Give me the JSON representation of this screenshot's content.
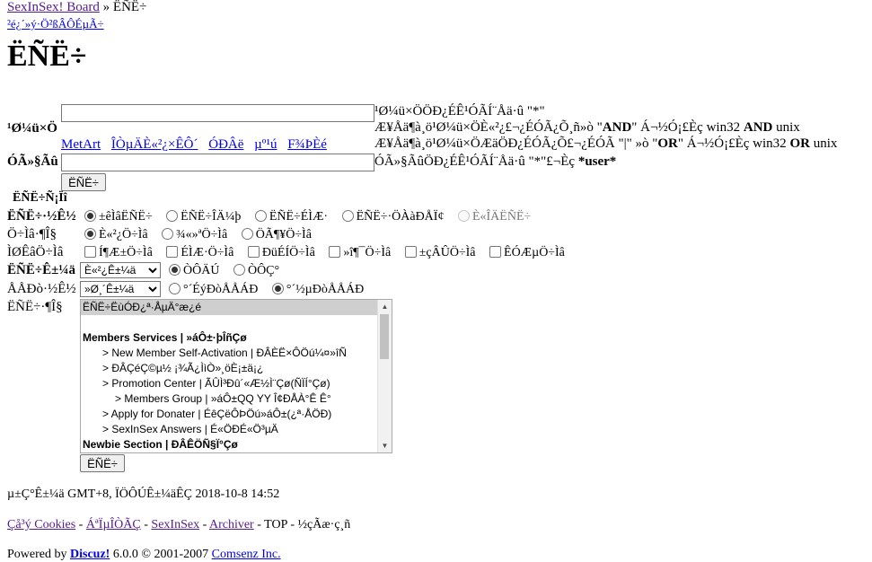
{
  "breadcrumb": {
    "board_link": "SexInSex! Board",
    "sep": "»",
    "current": "ËÑË÷",
    "sub_link": "²é¿´»ý·Ö²ßÂÔÉµÃ÷"
  },
  "page_title": "ËÑË÷",
  "form": {
    "keyword_label": "¹Ø¼ü×Ö",
    "keyword_hint": "¹Ø¼ü×ÖÖÐ¿ÉÊ¹ÓÃÍ¨Åä·û \"*\"",
    "keyword_hint2_a": "Æ¥Åä¶à¸ö¹Ø¼ü×ÖÈ«²¿£¬¿ÉÓÃ¿Õ¸ñ»ò \"",
    "keyword_hint2_b": "AND",
    "keyword_hint2_c": "\" Á¬½Ó¡£Èç win32 ",
    "keyword_hint2_d": "AND",
    "keyword_hint2_e": " unix",
    "keyword_hint3_a": "Æ¥Åä¶à¸ö¹Ø¼ü×ÖÆäÖÐ¿ÉÓÃ¿Õ£¬¿ÉÓÃ \"|\" »ò \"",
    "keyword_hint3_b": "OR",
    "keyword_hint3_c": "\" Á¬½Ó¡£Èç win32 ",
    "keyword_hint3_d": "OR",
    "keyword_hint3_e": " unix",
    "quick_links": [
      "MetArt",
      "ÎÒµÄÈ«²¿×ÊÔ´",
      "ÓÐÂë",
      "µº¹ú",
      "F¾ÞÈé"
    ],
    "author_label": "ÓÃ»§Ãû",
    "author_hint_a": "ÓÃ»§ÃûÖÐ¿ÉÊ¹ÓÃÍ¨Åä·û \"*\"£¬Èç ",
    "author_hint_b": "*user*",
    "search_button": "ËÑË÷",
    "options_title": "ËÑË÷Ñ¡Ïî",
    "mode_label": "ËÑË÷·½Ê½",
    "mode_options": [
      {
        "label": "±êÌâËÑË÷",
        "checked": true,
        "disabled": false
      },
      {
        "label": "ËÑË÷ÎÄ¼þ",
        "checked": false,
        "disabled": false
      },
      {
        "label": "ËÑË÷ÉÌÆ·",
        "checked": false,
        "disabled": false
      },
      {
        "label": "ËÑË÷·ÖÀàÐÅÏ¢",
        "checked": false,
        "disabled": false
      },
      {
        "label": "È«ÎÄËÑË÷",
        "checked": false,
        "disabled": true
      }
    ],
    "scope_label": "Ö÷Ìâ·¶Î§",
    "scope_options": [
      {
        "label": "È«²¿Ö÷Ìâ",
        "checked": true
      },
      {
        "label": "¾«»ªÖ÷Ìâ",
        "checked": false
      },
      {
        "label": "ÖÃ¶¥Ö÷Ìâ",
        "checked": false
      }
    ],
    "special_label": "ÌØÊâÖ÷Ìâ",
    "special_options": [
      "Í¶Æ±Ö÷Ìâ",
      "ÉÌÆ·Ö÷Ìâ",
      "ÐüÉÍÖ÷Ìâ",
      "»î¶¯Ö÷Ìâ",
      "±çÂÛÖ÷Ìâ",
      "ÊÓÆµÖ÷Ìâ"
    ],
    "time_label": "ËÑË÷Ê±¼ä",
    "time_select": "È«²¿Ê±¼ä",
    "time_radio": [
      {
        "label": "ÒÔÄÚ",
        "checked": true
      },
      {
        "label": "ÒÔÇ°",
        "checked": false
      }
    ],
    "order_label": "ÅÅÐò·½Ê½",
    "order_select": "»Ø¸´Ê±¼ä",
    "order_radio": [
      {
        "label": "°´ÉýÐòÅÅÁÐ",
        "checked": false
      },
      {
        "label": "°´½µÐòÅÅÁÐ",
        "checked": true
      }
    ],
    "forum_label": "ËÑË÷·¶Î§",
    "forum_list": [
      {
        "text": "ËÑË÷ËùÓÐ¿ª·ÅµÄ°æ¿é",
        "kind": "sel"
      },
      {
        "text": "",
        "kind": "blank"
      },
      {
        "text": "Members Services | »áÔ±·þÎñÇø",
        "kind": "grp"
      },
      {
        "text": "> New Member Self-Activation | ÐÂÈË×ÔÖú¼¤»îÑ",
        "kind": "i1"
      },
      {
        "text": "> ÐÂÇéÇ©µ½ ¡¾Ã¿ÌìÒ»¸öÈ¡±ä¡¿",
        "kind": "i1"
      },
      {
        "text": "> Promotion Center | ÃÛÌ³Ðû´«Æ½Ì¨Çø(ÑÏÍ°Çø)",
        "kind": "i1"
      },
      {
        "text": "> Members Group | »áÔ±QQ YY Î¢ÐÅÀ°Ê Ê°",
        "kind": "i2"
      },
      {
        "text": "> Apply for Donater | ÉêÇëÔÞÖú»áÔ±(¿ª·ÅÖÐ)",
        "kind": "i1"
      },
      {
        "text": "> SexInSex Answers | É«ÖÐÉ«Ö³µÄ",
        "kind": "i1"
      },
      {
        "text": "Newbie Section | ÐÂÊÖÑ§Ï°Çø",
        "kind": "grp"
      }
    ],
    "submit_button": "ËÑË÷"
  },
  "footer": {
    "time_text": "µ±Ç°Ê±¼ä GMT+8, ÏÖÔÚÊ±¼äÊÇ 2018-10-8 14:52",
    "links": [
      "Çå³ý Cookies",
      "ÁªÏµÎÒÃÇ",
      "SexInSex",
      "Archiver"
    ],
    "top_text": "TOP",
    "extra_text": "½çÃæ·ç¸ñ",
    "powered": "Powered by ",
    "discuz": "Discuz!",
    "version": " 6.0.0 © 2001-2007 ",
    "comsenz": "Comsenz Inc."
  }
}
